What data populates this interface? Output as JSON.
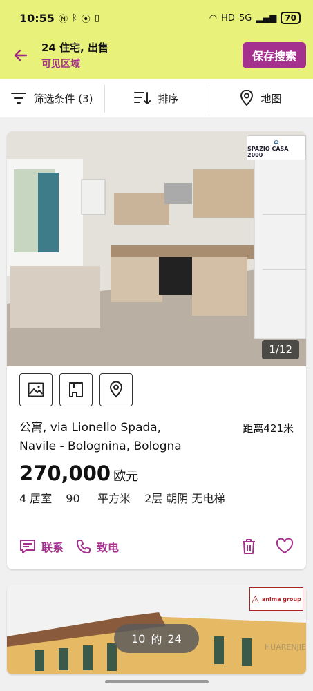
{
  "status_bar": {
    "time": "10:55",
    "battery": "70",
    "icons": [
      "nfc-icon",
      "bluetooth-icon",
      "location-icon",
      "vibrate-icon",
      "wifi-icon",
      "hd-icon",
      "5g-icon",
      "signal-icon"
    ]
  },
  "app_bar": {
    "title": "24 住宅, 出售",
    "subtitle": "可见区域",
    "save_label": "保存搜索"
  },
  "filter_bar": {
    "filter_label": "筛选条件 (3)",
    "sort_label": "排序",
    "map_label": "地图"
  },
  "listing1": {
    "agency_logo": "SPAZIO CASA 2000",
    "photo_counter": "1/12",
    "address_line1": "公寓, via Lionello Spada,",
    "address_line2": "Navile - Bolognina, Bologna",
    "distance": "距离421米",
    "price": "270,000",
    "currency": "欧元",
    "rooms": "4 居室",
    "area_value": "90",
    "area_unit": "平方米",
    "floor": "2层 朝阴 无电梯",
    "contact_label": "联系",
    "call_label": "致电"
  },
  "listing2": {
    "agency_logo": "anima group"
  },
  "pager": {
    "current": "10",
    "of_label": "的",
    "total": "24"
  },
  "watermark": "HUARENJIE",
  "colors": {
    "accent": "#a3318d",
    "header_bg": "#e8f27a"
  }
}
